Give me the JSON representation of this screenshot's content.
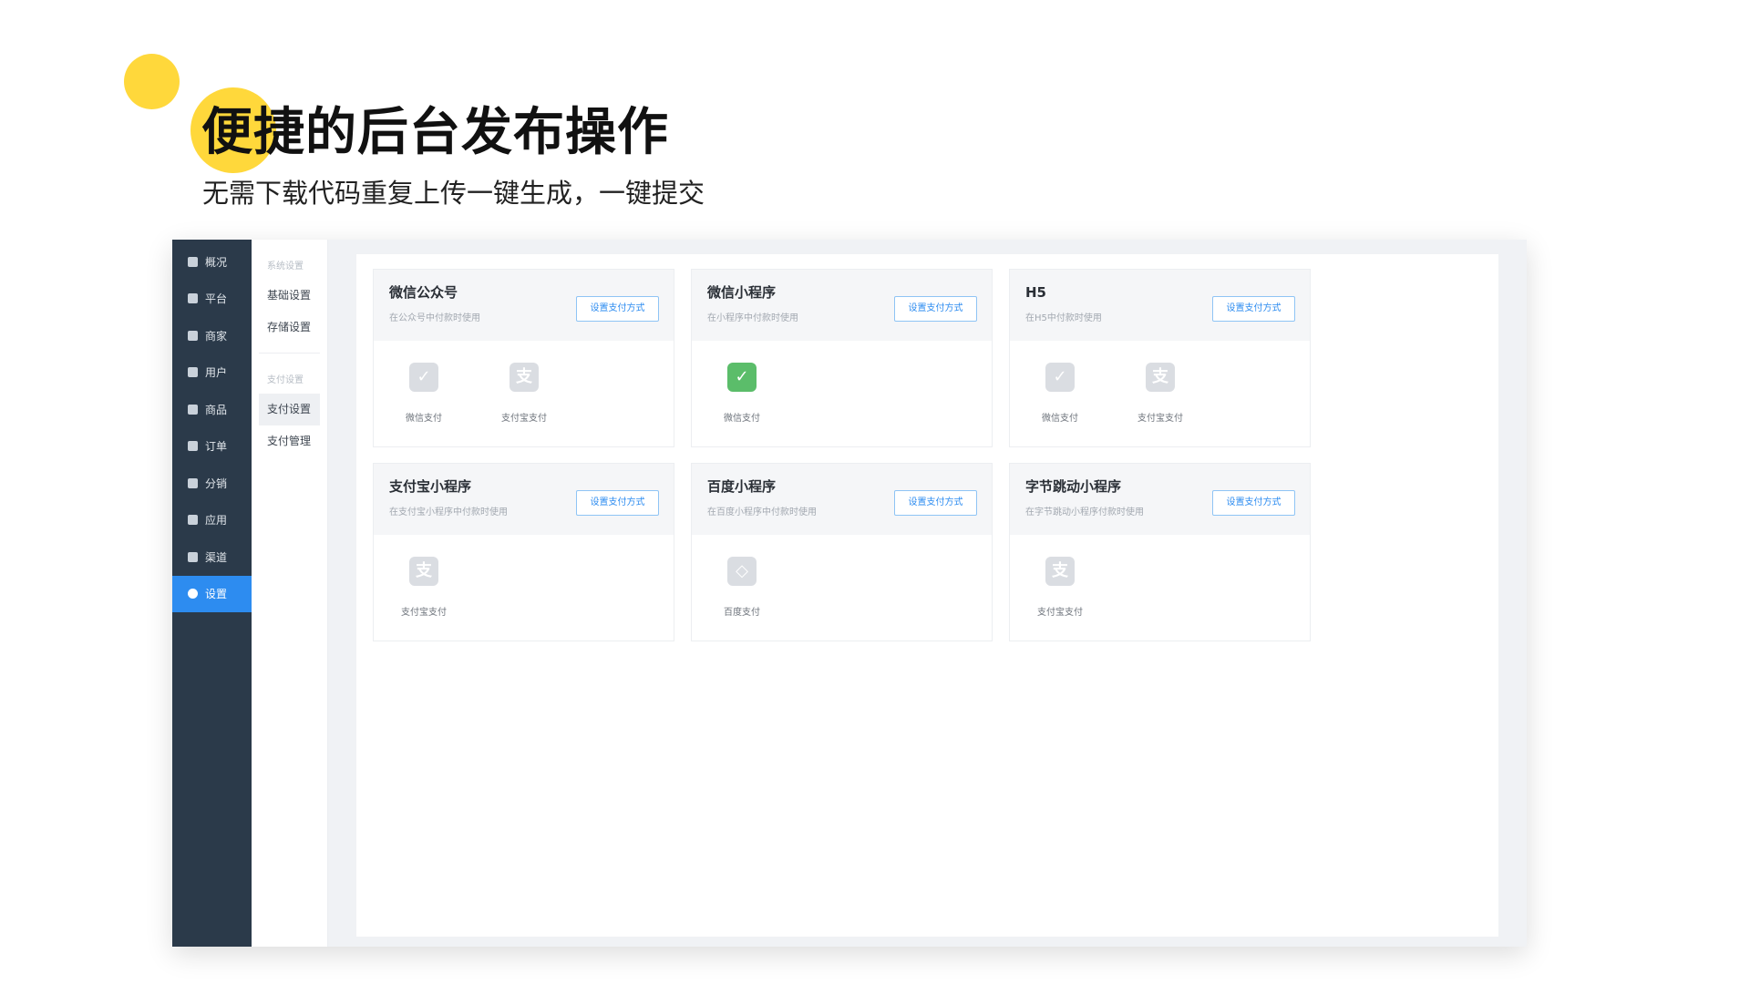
{
  "hero": {
    "title": "便捷的后台发布操作",
    "subtitle": "无需下载代码重复上传一键生成，一键提交",
    "accent_color": "#ffd83b"
  },
  "nav": {
    "items": [
      {
        "label": "概况",
        "icon": "overview-icon"
      },
      {
        "label": "平台",
        "icon": "platform-icon"
      },
      {
        "label": "商家",
        "icon": "merchant-icon"
      },
      {
        "label": "用户",
        "icon": "user-icon"
      },
      {
        "label": "商品",
        "icon": "product-icon"
      },
      {
        "label": "订单",
        "icon": "order-icon"
      },
      {
        "label": "分销",
        "icon": "distribution-icon"
      },
      {
        "label": "应用",
        "icon": "apps-icon"
      },
      {
        "label": "渠道",
        "icon": "channel-icon"
      },
      {
        "label": "设置",
        "icon": "gear-icon",
        "active": true
      }
    ],
    "active_color": "#2d8cf0"
  },
  "subnav": {
    "group1": "系统设置",
    "basic": "基础设置",
    "storage": "存储设置",
    "group2": "支付设置",
    "pay_settings": "支付设置",
    "pay_manage": "支付管理"
  },
  "cards": [
    {
      "title": "微信公众号",
      "desc": "在公众号中付款时使用",
      "button": "设置支付方式",
      "pays": [
        {
          "label": "微信支付",
          "icon": "wechat-pay-icon"
        },
        {
          "label": "支付宝支付",
          "icon": "alipay-icon"
        }
      ]
    },
    {
      "title": "微信小程序",
      "desc": "在小程序中付款时使用",
      "button": "设置支付方式",
      "pays": [
        {
          "label": "微信支付",
          "icon": "wechat-pay-icon",
          "active": true
        }
      ]
    },
    {
      "title": "H5",
      "desc": "在H5中付款时使用",
      "button": "设置支付方式",
      "pays": [
        {
          "label": "微信支付",
          "icon": "wechat-pay-icon"
        },
        {
          "label": "支付宝支付",
          "icon": "alipay-icon"
        }
      ]
    },
    {
      "title": "支付宝小程序",
      "desc": "在支付宝小程序中付款时使用",
      "button": "设置支付方式",
      "pays": [
        {
          "label": "支付宝支付",
          "icon": "alipay-icon"
        }
      ]
    },
    {
      "title": "百度小程序",
      "desc": "在百度小程序中付款时使用",
      "button": "设置支付方式",
      "pays": [
        {
          "label": "百度支付",
          "icon": "baidu-pay-icon"
        }
      ]
    },
    {
      "title": "字节跳动小程序",
      "desc": "在字节跳动小程序付款时使用",
      "button": "设置支付方式",
      "pays": [
        {
          "label": "支付宝支付",
          "icon": "alipay-icon"
        }
      ]
    }
  ]
}
